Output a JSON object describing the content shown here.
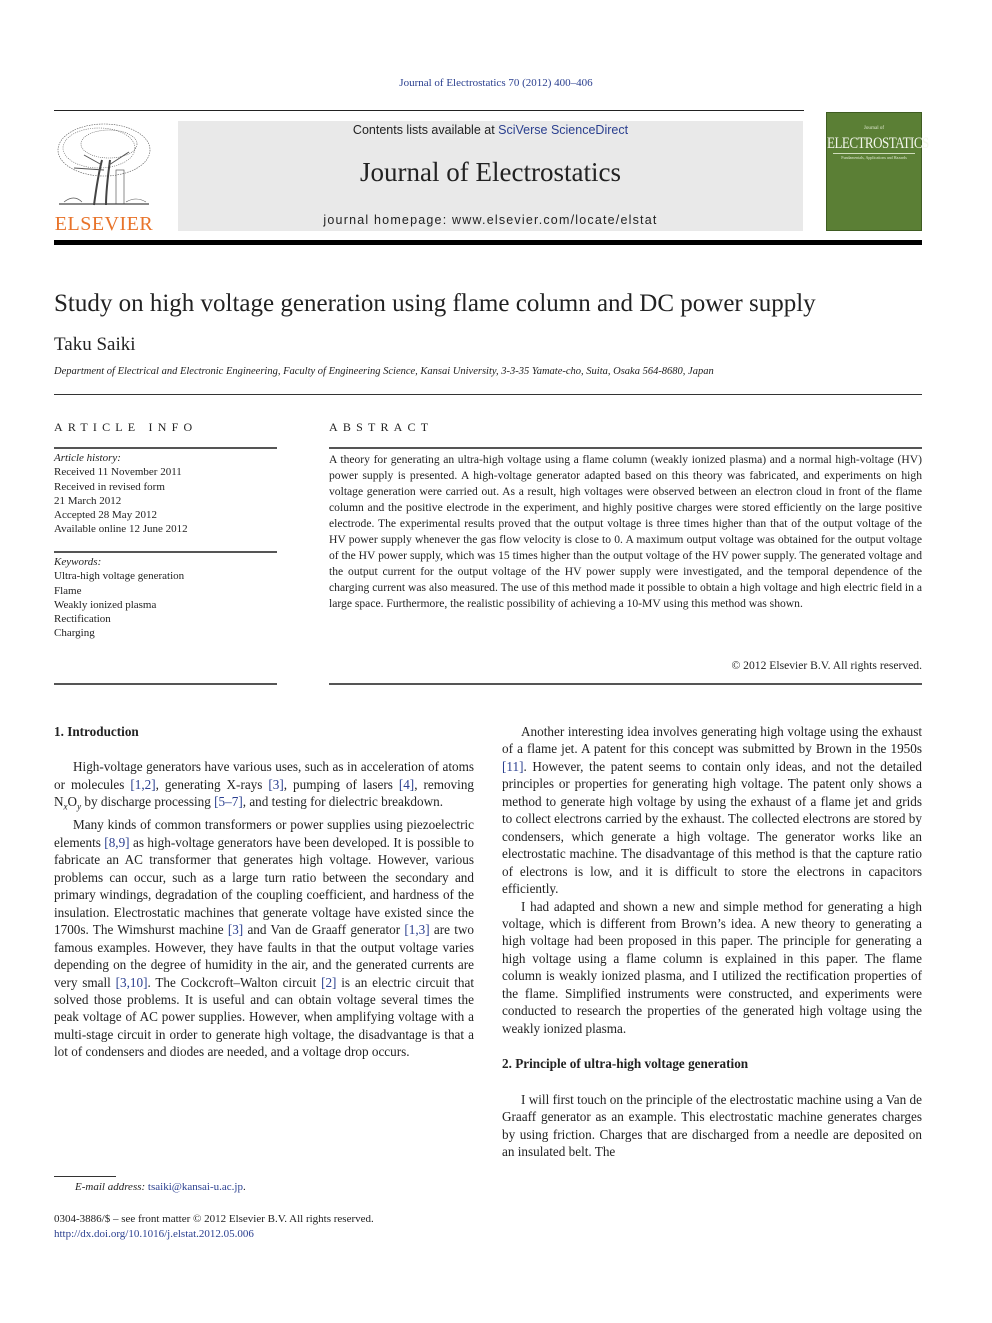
{
  "header": {
    "citation": "Journal of Electrostatics 70 (2012) 400–406",
    "contents_prefix": "Contents lists available at ",
    "contents_link": "SciVerse ScienceDirect",
    "journal_title": "Journal of Electrostatics",
    "homepage": "journal homepage: www.elsevier.com/locate/elstat",
    "publisher_logo_text": "ELSEVIER",
    "cover": {
      "small_text": "Journal of",
      "title": "ELECTROSTATICS",
      "subtitle": "Fundamentals, Applications and Hazards",
      "color": "#5b7f35"
    }
  },
  "article": {
    "title": "Study on high voltage generation using flame column and DC power supply",
    "author": "Taku Saiki",
    "affiliation": "Department of Electrical and Electronic Engineering, Faculty of Engineering Science, Kansai University, 3-3-35 Yamate-cho, Suita, Osaka 564-8680, Japan"
  },
  "article_info": {
    "heading": "ARTICLE INFO",
    "history_label": "Article history:",
    "history": [
      "Received 11 November 2011",
      "Received in revised form",
      "21 March 2012",
      "Accepted 28 May 2012",
      "Available online 12 June 2012"
    ],
    "keywords_label": "Keywords:",
    "keywords": [
      "Ultra-high voltage generation",
      "Flame",
      "Weakly ionized plasma",
      "Rectification",
      "Charging"
    ]
  },
  "abstract": {
    "heading": "ABSTRACT",
    "text": "A theory for generating an ultra-high voltage using a flame column (weakly ionized plasma) and a normal high-voltage (HV) power supply is presented. A high-voltage generator adapted based on this theory was fabricated, and experiments on high voltage generation were carried out. As a result, high voltages were observed between an electron cloud in front of the flame column and the positive elec­trode in the experiment, and highly positive charges were stored efficiently on the large positive elec­trode. The experimental results proved that the output voltage is three times higher than that of the output voltage of the HV power supply whenever the gas flow velocity is close to 0. A maximum output voltage was obtained for the output voltage of the HV power supply, which was 15 times higher than the output voltage of the HV power supply. The generated voltage and the output current for the output voltage of the HV power supply were investigated, and the temporal dependence of the charging current was also measured. The use of this method made it possible to obtain a high voltage and high electric field in a large space. Furthermore, the realistic possibility of achieving a 10-MV using this method was shown.",
    "copyright": "© 2012 Elsevier B.V. All rights reserved."
  },
  "body": {
    "section1_heading": "1.  Introduction",
    "p1": [
      {
        "t": "High-voltage generators have various uses, such as in accelera­tion of atoms or molecules "
      },
      {
        "ref": "[1,2]"
      },
      {
        "t": ", generating X-rays "
      },
      {
        "ref": "[3]"
      },
      {
        "t": ", pumping of lasers "
      },
      {
        "ref": "[4]"
      },
      {
        "t": ", removing N"
      },
      {
        "sub": "x"
      },
      {
        "t": "O"
      },
      {
        "sub": "y"
      },
      {
        "t": " by discharge processing "
      },
      {
        "ref": "[5–7]"
      },
      {
        "t": ", and testing for dielectric breakdown."
      }
    ],
    "p2": [
      {
        "t": "Many kinds of common transformers or power supplies using piezoelectric elements "
      },
      {
        "ref": "[8,9]"
      },
      {
        "t": " as high-voltage generators have been developed. It is possible to fabricate an AC transformer that generates high voltage. However, various problems can occur, such as a large turn ratio between the secondary and primary windings, degradation of the coupling coefficient, and hardness of the insu­lation. Electrostatic machines that generate voltage have existed since the 1700s. The Wimshurst machine "
      },
      {
        "ref": "[3]"
      },
      {
        "t": " and Van de Graaff generator "
      },
      {
        "ref": "[1,3]"
      },
      {
        "t": " are two famous examples. However, they have faults in that the output voltage varies depending on the degree of humidity in the air, and the generated currents are very small "
      },
      {
        "ref": "[3,10]"
      },
      {
        "t": ". The Cockcroft–Walton circuit "
      },
      {
        "ref": "[2]"
      },
      {
        "t": " is an electric circuit that solved those problems. It is useful and can obtain voltage several times the peak voltage of AC power supplies. However, when amplifying voltage with a multi-stage circuit in order to generate high voltage, the disadvantage is that a lot of condensers and diodes are needed, and a voltage drop occurs."
      }
    ],
    "p3": [
      {
        "t": "Another interesting idea involves generating high voltage using the exhaust of a flame jet. A patent for this concept was submitted by Brown in the 1950s "
      },
      {
        "ref": "[11]"
      },
      {
        "t": ". However, the patent seems to contain only ideas, and not the detailed principles or properties for generating high voltage. The patent only shows a method to generate high voltage by using the exhaust of a flame jet and grids to collect electrons carried by the exhaust. The collected electrons are stored by condensers, which generate a high voltage. The generator works like an electrostatic machine. The disadvantage of this method is that the capture ratio of electrons is low, and it is difficult to store the electrons in capacitors efficiently."
      }
    ],
    "p4": [
      {
        "t": "I had adapted and shown a new and simple method for gener­ating a high voltage, which is different from Brown’s idea. A new theory to generating a high voltage had been proposed in this paper. The principle for generating a high voltage using a flame column is explained in this paper. The flame column is weakly ionized plasma, and I utilized the rectification properties of the flame. Simplified instruments were constructed, and experiments were conducted to research the properties of the generated high voltage using the weakly ionized plasma."
      }
    ],
    "section2_heading": "2.  Principle of ultra-high voltage generation",
    "p5": [
      {
        "t": "I will first touch on the principle of the electrostatic machine using a Van de Graaff generator as an example. This electrostatic machine generates charges by using friction. Charges that are dis­charged from a needle are deposited on an insulated belt. The"
      }
    ]
  },
  "footnote": {
    "email_label": "E-mail address: ",
    "email": "tsaiki@kansai-u.ac.jp",
    "email_suffix": ".",
    "front_matter": "0304-3886/$ – see front matter © 2012 Elsevier B.V. All rights reserved.",
    "doi": "http://dx.doi.org/10.1016/j.elstat.2012.05.006"
  },
  "colors": {
    "link": "#2a3f8f",
    "elsevier_orange": "#e8732a",
    "banner_bg": "#e9e9e9"
  }
}
